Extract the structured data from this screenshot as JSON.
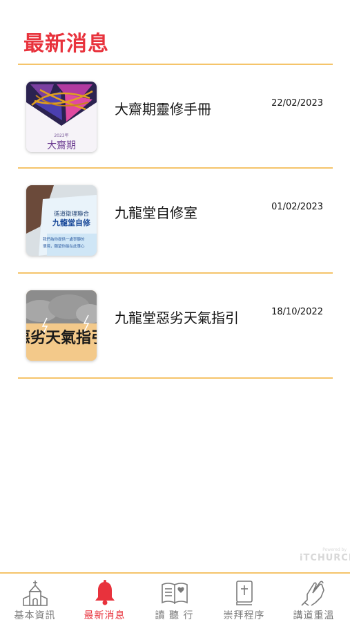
{
  "header": {
    "title": "最新消息"
  },
  "news": [
    {
      "title": "大齋期靈修手冊",
      "date": "22/02/2023",
      "thumb_year": "2023年",
      "thumb_text": "大齋期"
    },
    {
      "title": "九龍堂自修室",
      "date": "01/02/2023",
      "thumb_line1": "循道衛理聯合",
      "thumb_line2": "九龍堂自修",
      "thumb_line3": "我們為你提供一處寧靜的",
      "thumb_line4": "環境，願望你能在此專心"
    },
    {
      "title": "九龍堂惡劣天氣指引",
      "date": "18/10/2022",
      "thumb_text": "惡劣天氣指引"
    }
  ],
  "watermark": {
    "small": "Powered by",
    "big": "iTCHURCH"
  },
  "tabs": [
    {
      "label": "基本資訊",
      "icon": "church-icon"
    },
    {
      "label": "最新消息",
      "icon": "bell-icon"
    },
    {
      "label": "讀 聽 行",
      "icon": "open-book-icon"
    },
    {
      "label": "崇拜程序",
      "icon": "bible-icon"
    },
    {
      "label": "講道重溫",
      "icon": "praying-hands-icon"
    }
  ],
  "colors": {
    "accent": "#e8323c",
    "divider": "#f5c46a",
    "tab_inactive": "#7a7a7a"
  }
}
